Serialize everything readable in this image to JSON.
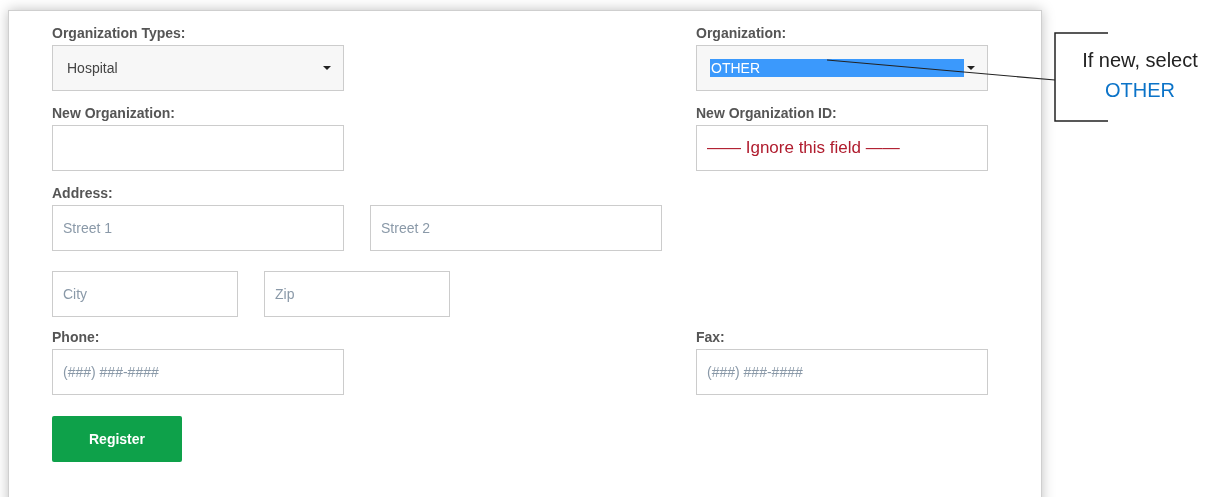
{
  "form": {
    "org_type": {
      "label": "Organization Types:",
      "value": "Hospital"
    },
    "organization": {
      "label": "Organization:",
      "value": "OTHER",
      "highlighted": true
    },
    "new_organization": {
      "label": "New Organization:"
    },
    "new_organization_id": {
      "label": "New Organization ID:",
      "annotation": "—— Ignore this field ——"
    },
    "address": {
      "label": "Address:",
      "fields": [
        {
          "placeholder": "Street 1"
        },
        {
          "placeholder": "Street 2"
        },
        {
          "placeholder": "City"
        },
        {
          "placeholder": "Zip"
        }
      ]
    },
    "phone": {
      "label": "Phone:",
      "placeholder": "(###) ###-####"
    },
    "fax": {
      "label": "Fax:",
      "placeholder": "(###) ###-####"
    },
    "submit": "Register"
  },
  "callout": {
    "text": "If new, select",
    "highlight": "OTHER"
  }
}
